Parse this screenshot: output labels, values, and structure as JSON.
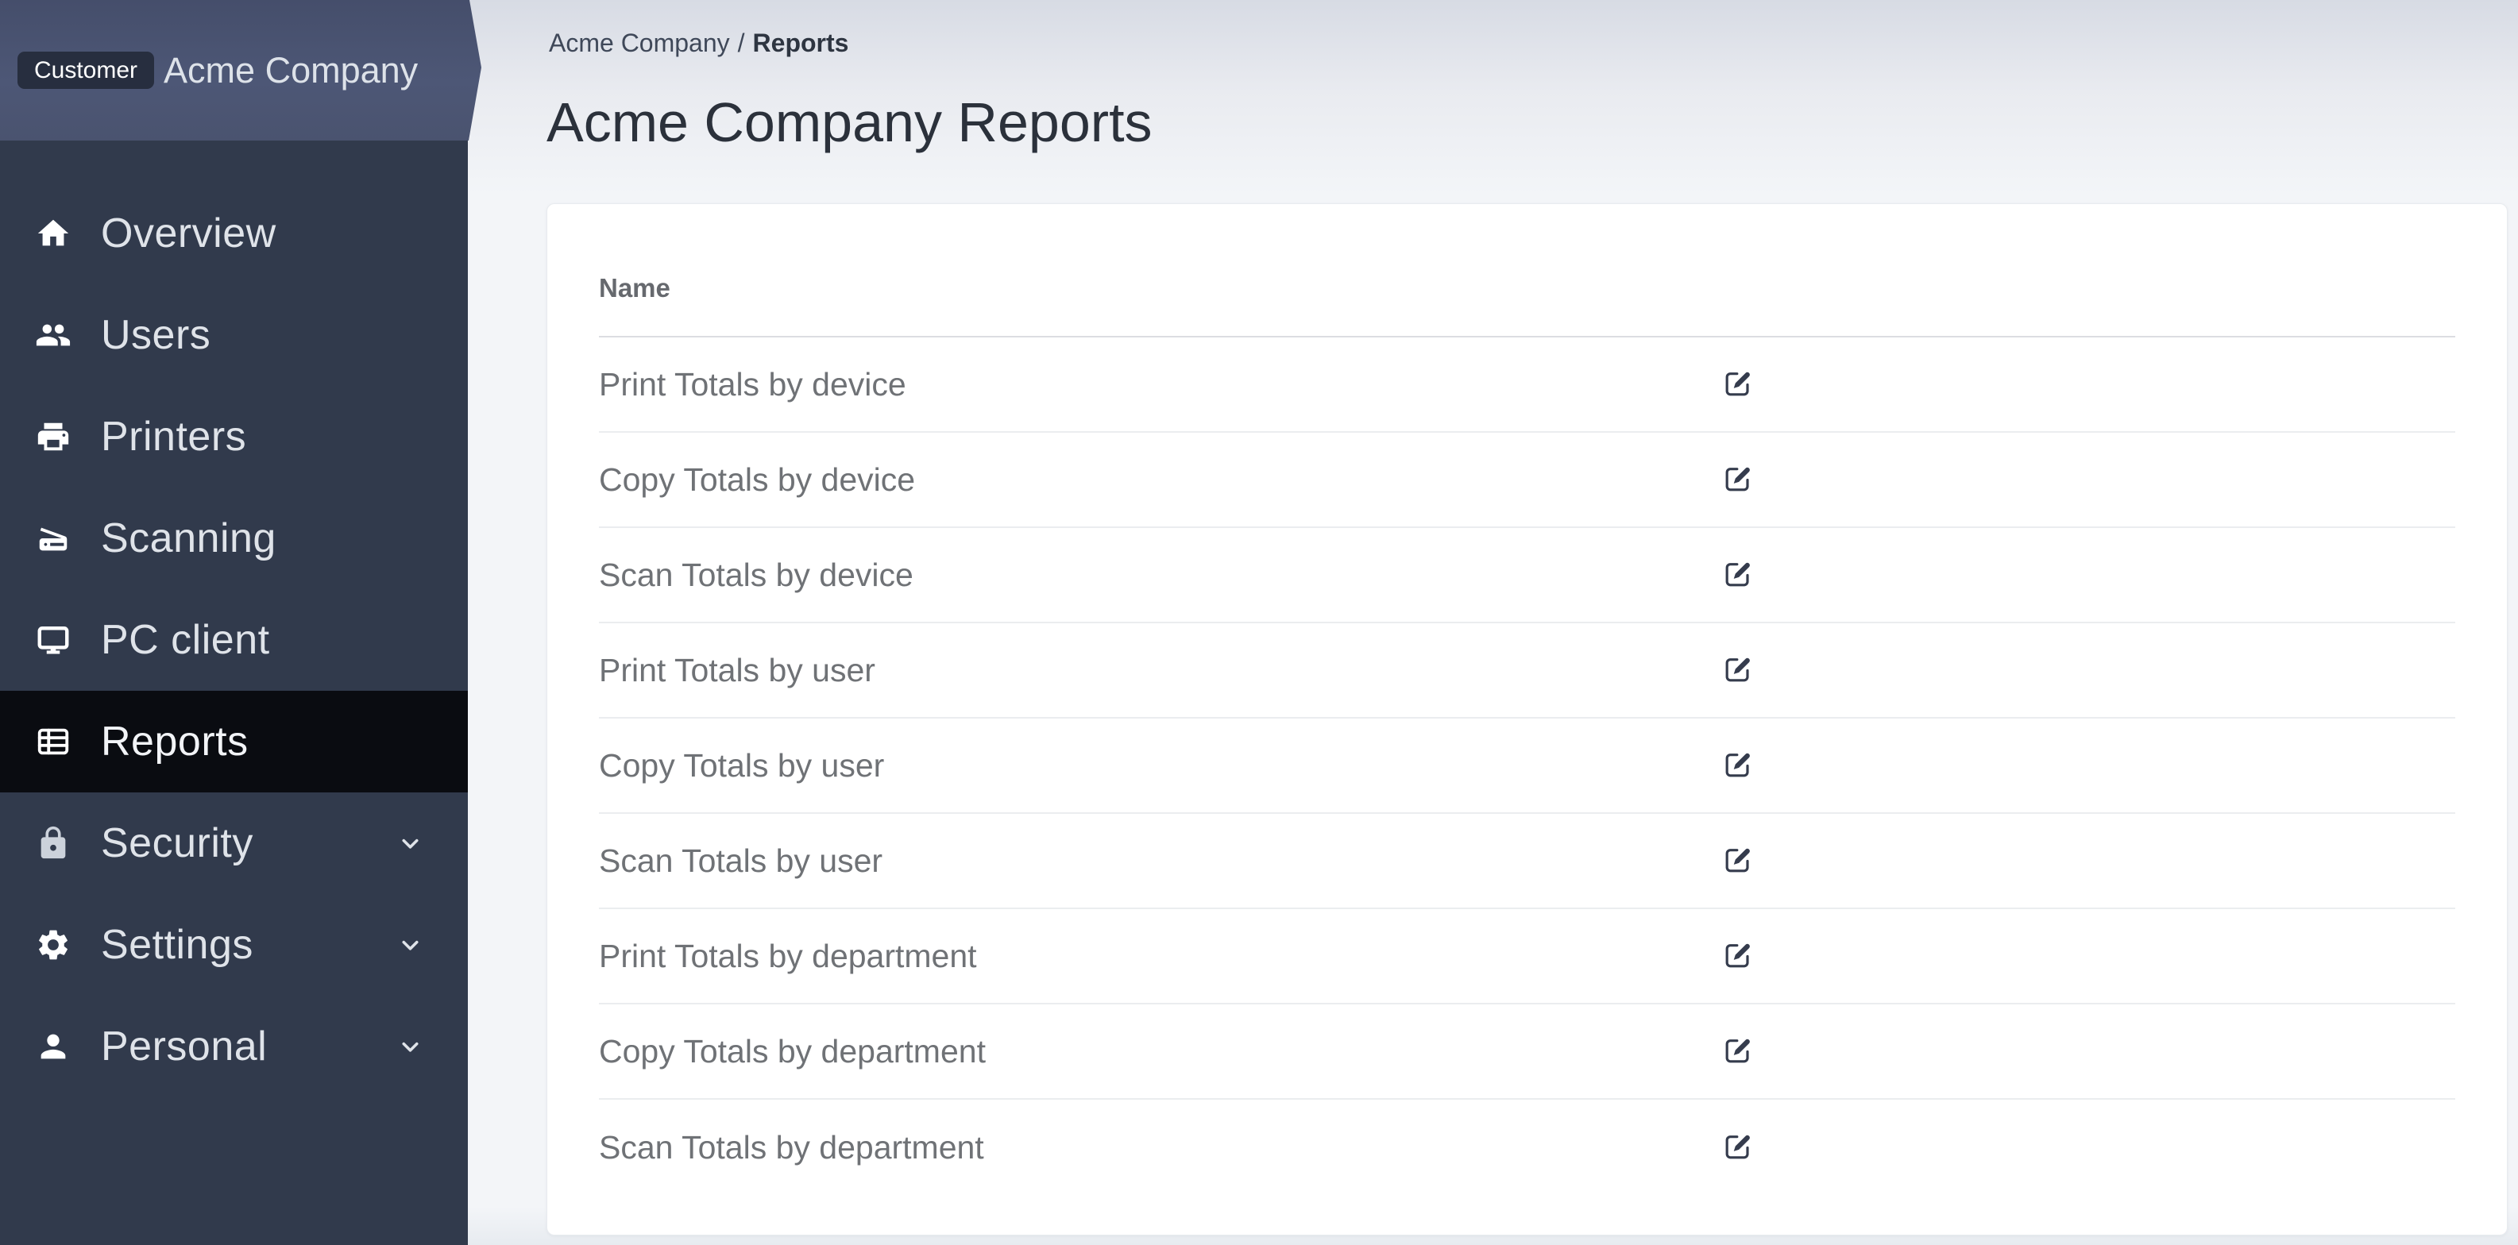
{
  "sidebar": {
    "badge": "Customer",
    "company": "Acme Company",
    "items": [
      {
        "id": "overview",
        "label": "Overview",
        "icon": "home",
        "active": false,
        "expandable": false
      },
      {
        "id": "users",
        "label": "Users",
        "icon": "users",
        "active": false,
        "expandable": false
      },
      {
        "id": "printers",
        "label": "Printers",
        "icon": "printer",
        "active": false,
        "expandable": false
      },
      {
        "id": "scanning",
        "label": "Scanning",
        "icon": "scanner",
        "active": false,
        "expandable": false
      },
      {
        "id": "pc-client",
        "label": "PC client",
        "icon": "desktop",
        "active": false,
        "expandable": false
      },
      {
        "id": "reports",
        "label": "Reports",
        "icon": "table-list",
        "active": true,
        "expandable": false
      },
      {
        "id": "security",
        "label": "Security",
        "icon": "lock",
        "active": false,
        "expandable": true
      },
      {
        "id": "settings",
        "label": "Settings",
        "icon": "gear",
        "active": false,
        "expandable": true
      },
      {
        "id": "personal",
        "label": "Personal",
        "icon": "person",
        "active": false,
        "expandable": true
      }
    ]
  },
  "breadcrumb": {
    "parent": "Acme Company",
    "separator": "/",
    "current": "Reports"
  },
  "page": {
    "title": "Acme Company Reports"
  },
  "table": {
    "columns": [
      {
        "label": "Name"
      }
    ],
    "rows": [
      {
        "name": "Print Totals by device",
        "action_icon": "edit"
      },
      {
        "name": "Copy Totals by device",
        "action_icon": "edit"
      },
      {
        "name": "Scan Totals by device",
        "action_icon": "edit"
      },
      {
        "name": "Print Totals by user",
        "action_icon": "edit"
      },
      {
        "name": "Copy Totals by user",
        "action_icon": "edit"
      },
      {
        "name": "Scan Totals by user",
        "action_icon": "edit"
      },
      {
        "name": "Print Totals by department",
        "action_icon": "edit"
      },
      {
        "name": "Copy Totals by department",
        "action_icon": "edit"
      },
      {
        "name": "Scan Totals by department",
        "action_icon": "edit"
      }
    ]
  },
  "colors": {
    "sidebar_bg": "#313a4c",
    "sidebar_active_bg": "#0a0c11",
    "sidebar_header_bg": "#4d5776",
    "badge_bg": "#272e3f",
    "main_bg": "#f3f5f8",
    "card_bg": "#ffffff",
    "row_text": "#6f7276",
    "edit_icon": "#353c4d"
  }
}
